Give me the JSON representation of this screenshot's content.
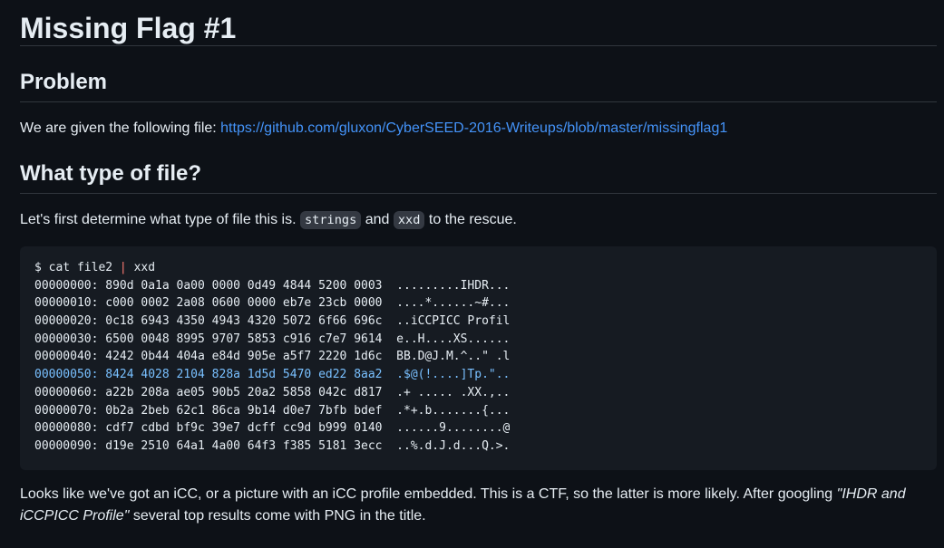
{
  "title": "Missing Flag #1",
  "sections": {
    "problem": {
      "heading": "Problem",
      "intro": "We are given the following file: ",
      "link": "https://github.com/gluxon/CyberSEED-2016-Writeups/blob/master/missingflag1"
    },
    "file_type": {
      "heading": "What type of file?",
      "text_before": "Let's first determine what type of file this is. ",
      "code1": "strings",
      "text_mid": " and ",
      "code2": "xxd",
      "text_after": " to the rescue."
    }
  },
  "code_block": {
    "command_prefix": "$ cat file2 ",
    "command_pipe": "|",
    "command_suffix": " xxd",
    "lines": [
      "00000000: 890d 0a1a 0a00 0000 0d49 4844 5200 0003  .........IHDR...",
      "00000010: c000 0002 2a08 0600 0000 eb7e 23cb 0000  ....*......~#...",
      "00000020: 0c18 6943 4350 4943 4320 5072 6f66 696c  ..iCCPICC Profil",
      "00000030: 6500 0048 8995 9707 5853 c916 c7e7 9614  e..H....XS......",
      "00000040: 4242 0b44 404a e84d 905e a5f7 2220 1d6c  BB.D@J.M.^..\" .l",
      "00000050: 8424 4028 2104 828a 1d5d 5470 ed22 8aa2  .$@(!....]Tp.\"..",
      "00000060: a22b 208a ae05 90b5 20a2 5858 042c d817  .+ ..... .XX.,..",
      "00000070: 0b2a 2beb 62c1 86ca 9b14 d0e7 7bfb bdef  .*+.b.......{...",
      "00000080: cdf7 cdbd bf9c 39e7 dcff cc9d b999 0140  ......9........@",
      "00000090: d19e 2510 64a1 4a00 64f3 f385 5181 3ecc  ..%.d.J.d...Q.>."
    ]
  },
  "conclusion": {
    "text_before": "Looks like we've got an iCC, or a picture with an iCC profile embedded. This is a CTF, so the latter is more likely. After googling ",
    "emphasis": "\"IHDR and iCCPICC Profile\"",
    "text_after": " several top results come with PNG in the title."
  }
}
